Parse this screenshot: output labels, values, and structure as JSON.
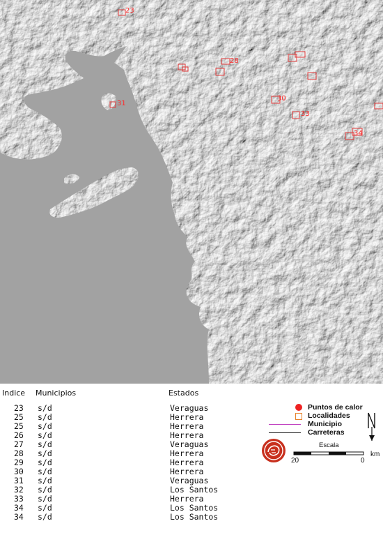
{
  "map": {
    "point_labels": [
      "23",
      "28",
      "31",
      "30",
      "33",
      "34"
    ]
  },
  "table": {
    "headers": {
      "indice": "Indice",
      "municipios": "Municipios",
      "estados": "Estados"
    },
    "rows": [
      {
        "indice": "23",
        "municipio": "s/d",
        "estado": "Veraguas"
      },
      {
        "indice": "25",
        "municipio": "s/d",
        "estado": "Herrera"
      },
      {
        "indice": "25",
        "municipio": "s/d",
        "estado": "Herrera"
      },
      {
        "indice": "26",
        "municipio": "s/d",
        "estado": "Herrera"
      },
      {
        "indice": "27",
        "municipio": "s/d",
        "estado": "Veraguas"
      },
      {
        "indice": "28",
        "municipio": "s/d",
        "estado": "Herrera"
      },
      {
        "indice": "29",
        "municipio": "s/d",
        "estado": "Herrera"
      },
      {
        "indice": "30",
        "municipio": "s/d",
        "estado": "Herrera"
      },
      {
        "indice": "31",
        "municipio": "s/d",
        "estado": "Veraguas"
      },
      {
        "indice": "32",
        "municipio": "s/d",
        "estado": "Los Santos"
      },
      {
        "indice": "33",
        "municipio": "s/d",
        "estado": "Herrera"
      },
      {
        "indice": "34",
        "municipio": "s/d",
        "estado": "Los Santos"
      },
      {
        "indice": "34",
        "municipio": "s/d",
        "estado": "Los Santos"
      }
    ]
  },
  "legend": {
    "hotspots": "Puntos de calor",
    "localities": "Localidades",
    "municipality": "Municipio",
    "roads": "Carreteras",
    "scale_title": "Escala",
    "scale_left": "20",
    "scale_right": "0",
    "scale_unit": "km",
    "north": "N",
    "colors": {
      "hotspot": "#ee2222",
      "locality": "#e8822a",
      "municipality": "#c040c0",
      "road": "#111111"
    }
  }
}
